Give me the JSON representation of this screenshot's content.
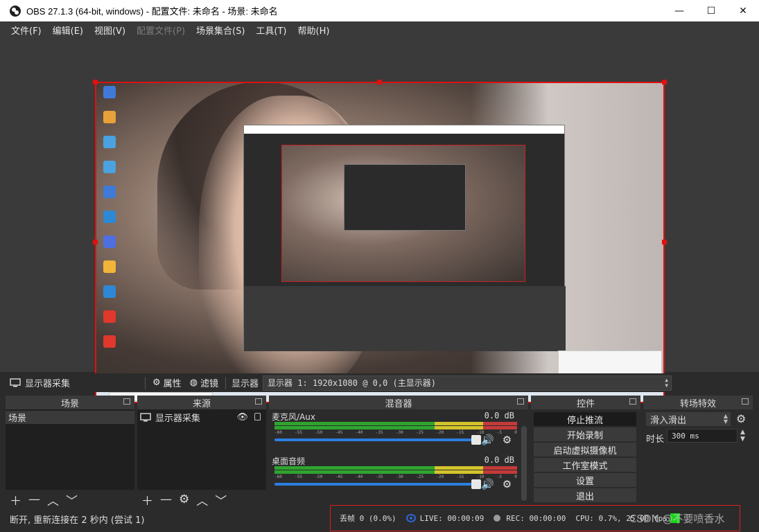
{
  "window": {
    "title": "OBS 27.1.3 (64-bit, windows) - 配置文件: 未命名 - 场景: 未命名",
    "minimize": "—",
    "maximize": "☐",
    "close": "✕"
  },
  "menu": [
    "文件(F)",
    "编辑(E)",
    "视图(V)",
    "配置文件(P)",
    "场景集合(S)",
    "工具(T)",
    "帮助(H)"
  ],
  "source_toolbar": {
    "selected_source": "显示器采集",
    "properties_label": "属性",
    "filters_label": "滤镜",
    "display_label": "显示器",
    "display_value": "显示器 1: 1920x1080 @ 0,0 (主显示器)"
  },
  "scenes": {
    "title": "场景",
    "items": [
      "场景"
    ]
  },
  "sources": {
    "title": "来源",
    "items": [
      "显示器采集"
    ]
  },
  "mixer": {
    "title": "混音器",
    "channels": [
      {
        "name": "麦克风/Aux",
        "db": "0.0 dB"
      },
      {
        "name": "桌面音频",
        "db": "0.0 dB"
      }
    ],
    "scale": [
      "-60",
      "-55",
      "-50",
      "-45",
      "-40",
      "-35",
      "-30",
      "-25",
      "-20",
      "-15",
      "-10",
      "-5",
      "0"
    ]
  },
  "controls": {
    "title": "控件",
    "buttons": [
      "停止推流",
      "开始录制",
      "启动虚拟摄像机",
      "工作室模式",
      "设置",
      "退出"
    ]
  },
  "transitions": {
    "title": "转场特效",
    "selected": "滑入滑出",
    "duration_label": "时长",
    "duration_value": "300 ms"
  },
  "status": {
    "connection": "断开, 重新连接在 2 秒内 (尝试 1)",
    "dropped_frames": "丢帧 0 (0.0%)",
    "live": "LIVE: 00:00:09",
    "rec": "REC: 00:00:00",
    "cpu": "CPU: 0.7%, 25.00 fps",
    "watermark": "CSDN @不要喷香水"
  },
  "colors": {
    "selection": "#e01010",
    "status_highlight": "#d82222",
    "live_icon": "#2f66d8",
    "stream_ok": "#19d319"
  }
}
